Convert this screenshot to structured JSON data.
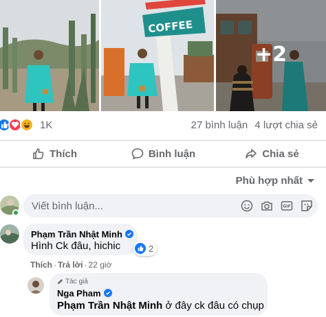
{
  "post": {
    "photos": [
      {
        "name": "cactus-garden-photo"
      },
      {
        "name": "coffee-sign-photo"
      },
      {
        "name": "gas-pump-photo",
        "more_count": "+2"
      }
    ],
    "reactions": {
      "icons": [
        "like-icon",
        "love-icon",
        "haha-icon"
      ],
      "count": "1K"
    },
    "comment_count": "27 bình luận",
    "share_count": "4 lượt chia sẻ",
    "actions": {
      "like_label": "Thích",
      "comment_label": "Bình luận",
      "share_label": "Chia sẻ"
    },
    "sort_label": "Phù hợp nhất"
  },
  "composer": {
    "placeholder": "Viết bình luận...",
    "tools": [
      "emoji-icon",
      "camera-icon",
      "gif-icon",
      "sticker-icon"
    ]
  },
  "comments": [
    {
      "author": "Phạm Trần Nhật Minh",
      "verified": true,
      "text": "Hình Ck đâu, hichic",
      "reaction_count": "2",
      "like_label": "Thích",
      "reply_label": "Trả lời",
      "time": "22 giờ",
      "replies": [
        {
          "badge": "Tác giả",
          "author": "Nga Pham",
          "verified": true,
          "mention": "Phạm Trần Nhật Minh",
          "text": "ở đây ck đâu có chụp"
        }
      ]
    }
  ],
  "colors": {
    "brand_blue": "#1877f2",
    "love_red": "#f33e58",
    "haha_yellow": "#f7b125",
    "secondary_text": "#65676b",
    "bubble_bg": "#f0f2f5",
    "online_green": "#31a24c"
  }
}
